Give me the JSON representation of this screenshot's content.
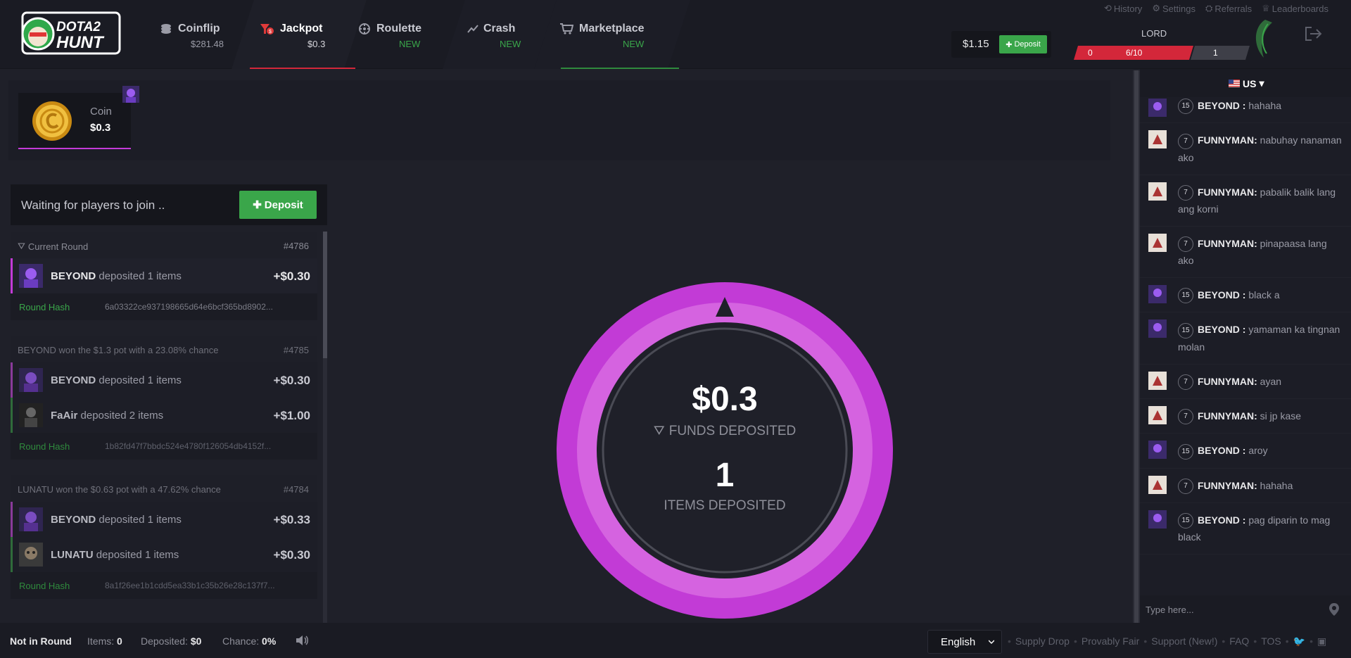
{
  "nav": {
    "logo_text_1": "DOTA2",
    "logo_text_2": "HUNT",
    "tabs": [
      {
        "label": "Coinflip",
        "sub": "$281.48"
      },
      {
        "label": "Jackpot",
        "sub": "$0.3"
      },
      {
        "label": "Roulette",
        "sub": "NEW"
      },
      {
        "label": "Crash",
        "sub": "NEW"
      },
      {
        "label": "Marketplace",
        "sub": "NEW"
      }
    ],
    "top_links": [
      "History",
      "Settings",
      "Referrals",
      "Leaderboards"
    ],
    "balance": "$1.15",
    "deposit_label": "Deposit",
    "user_name": "LORD",
    "level_left": "0",
    "level_progress": "6/10",
    "level_right": "1"
  },
  "pot_items": {
    "coin_name": "Coin",
    "coin_value": "$0.3"
  },
  "status": {
    "waiting_text": "Waiting for players to join ..",
    "deposit_label": "Deposit"
  },
  "rounds": [
    {
      "title": "Current Round",
      "id": "#4786",
      "deposits": [
        {
          "name": "BEYOND",
          "rest": "deposited 1 items",
          "amount": "+$0.30"
        }
      ],
      "hash_label": "Round Hash",
      "hash": "6a03322ce937198665d64e6bcf365bd8902..."
    },
    {
      "title": "BEYOND won the $1.3 pot with a 23.08% chance",
      "id": "#4785",
      "deposits": [
        {
          "name": "BEYOND",
          "rest": "deposited 1 items",
          "amount": "+$0.30"
        },
        {
          "name": "FaAir",
          "rest": "deposited 2 items",
          "amount": "+$1.00"
        }
      ],
      "hash_label": "Round Hash",
      "hash": "1b82fd47f7bbdc524e4780f126054db4152f..."
    },
    {
      "title": "LUNATU won the $0.63 pot with a 47.62% chance",
      "id": "#4784",
      "deposits": [
        {
          "name": "BEYOND",
          "rest": "deposited 1 items",
          "amount": "+$0.33"
        },
        {
          "name": "LUNATU",
          "rest": "deposited 1 items",
          "amount": "+$0.30"
        }
      ],
      "hash_label": "Round Hash",
      "hash": "8a1f26ee1b1cdd5ea33b1c35b26e28c137f7..."
    }
  ],
  "wheel": {
    "amount": "$0.3",
    "funds_label": "FUNDS DEPOSITED",
    "items_count": "1",
    "items_label": "ITEMS DEPOSITED",
    "ring_color": "#c23bd6",
    "ring_inner_color": "#d563e0"
  },
  "chat": {
    "lang": "US",
    "placeholder": "Type here...",
    "messages": [
      {
        "level": "15",
        "user": "BEYOND :",
        "text": "hahaha"
      },
      {
        "level": "7",
        "user": "FUNNYMAN:",
        "text": "nabuhay nanaman ako"
      },
      {
        "level": "7",
        "user": "FUNNYMAN:",
        "text": "pabalik balik lang ang korni"
      },
      {
        "level": "7",
        "user": "FUNNYMAN:",
        "text": "pinapaasa lang ako"
      },
      {
        "level": "15",
        "user": "BEYOND :",
        "text": "black a"
      },
      {
        "level": "15",
        "user": "BEYOND :",
        "text": "yamaman ka tingnan molan"
      },
      {
        "level": "7",
        "user": "FUNNYMAN:",
        "text": "ayan"
      },
      {
        "level": "7",
        "user": "FUNNYMAN:",
        "text": "si jp kase"
      },
      {
        "level": "15",
        "user": "BEYOND :",
        "text": "aroy"
      },
      {
        "level": "7",
        "user": "FUNNYMAN:",
        "text": "hahaha"
      },
      {
        "level": "15",
        "user": "BEYOND :",
        "text": "pag diparin to mag black"
      }
    ]
  },
  "footer": {
    "not_in_round": "Not in Round",
    "items_label": "Items:",
    "items_value": "0",
    "deposited_label": "Deposited:",
    "deposited_value": "$0",
    "chance_label": "Chance:",
    "chance_value": "0%",
    "language": "English",
    "links": [
      "Supply Drop",
      "Provably Fair",
      "Support (New!)",
      "FAQ",
      "TOS"
    ]
  }
}
